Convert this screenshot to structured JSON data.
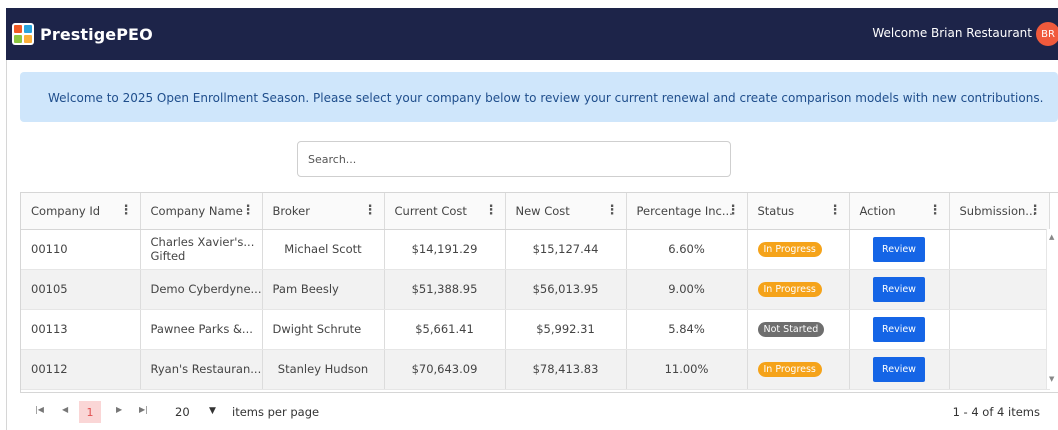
{
  "app": {
    "brand": "PrestigePEO",
    "welcome": "Welcome Brian Restaurant",
    "avatar_initials": "BR",
    "colors": {
      "topbar": "#1d2449",
      "avatar": "#f05a3c",
      "banner": "#cfe6fb",
      "accent": "#1565e6"
    }
  },
  "banner": {
    "text": "Welcome to 2025 Open Enrollment Season. Please select your company below to review your current renewal and create comparison models with new contributions."
  },
  "search": {
    "placeholder": "Search..."
  },
  "table": {
    "columns": [
      "Company Id",
      "Company Name",
      "Broker",
      "Current Cost",
      "New Cost",
      "Percentage Inc...",
      "Status",
      "Action",
      "Submission..."
    ],
    "rows": [
      {
        "company_id": "00110",
        "company_name": "Charles Xavier's... Gifted",
        "broker": "Michael Scott",
        "current_cost": "$14,191.29",
        "new_cost": "$15,127.44",
        "percentage": "6.60%",
        "status": "In Progress",
        "status_color": "#f5a31a",
        "action": "Review",
        "submission": ""
      },
      {
        "company_id": "00105",
        "company_name": "Demo Cyberdyne...",
        "broker": "Pam Beesly",
        "current_cost": "$51,388.95",
        "new_cost": "$56,013.95",
        "percentage": "9.00%",
        "status": "In Progress",
        "status_color": "#f5a31a",
        "action": "Review",
        "submission": ""
      },
      {
        "company_id": "00113",
        "company_name": "Pawnee Parks &...",
        "broker": "Dwight Schrute",
        "current_cost": "$5,661.41",
        "new_cost": "$5,992.31",
        "percentage": "5.84%",
        "status": "Not Started",
        "status_color": "#6e6e6e",
        "action": "Review",
        "submission": ""
      },
      {
        "company_id": "00112",
        "company_name": "Ryan's Restauran...",
        "broker": "Stanley Hudson",
        "current_cost": "$70,643.09",
        "new_cost": "$78,413.83",
        "percentage": "11.00%",
        "status": "In Progress",
        "status_color": "#f5a31a",
        "action": "Review",
        "submission": ""
      }
    ]
  },
  "pager": {
    "current_page": "1",
    "page_size": "20",
    "page_size_label": "items per page",
    "info": "1 - 4 of 4 items",
    "icons": [
      "first-page-icon",
      "prev-page-icon",
      "next-page-icon",
      "last-page-icon"
    ]
  }
}
